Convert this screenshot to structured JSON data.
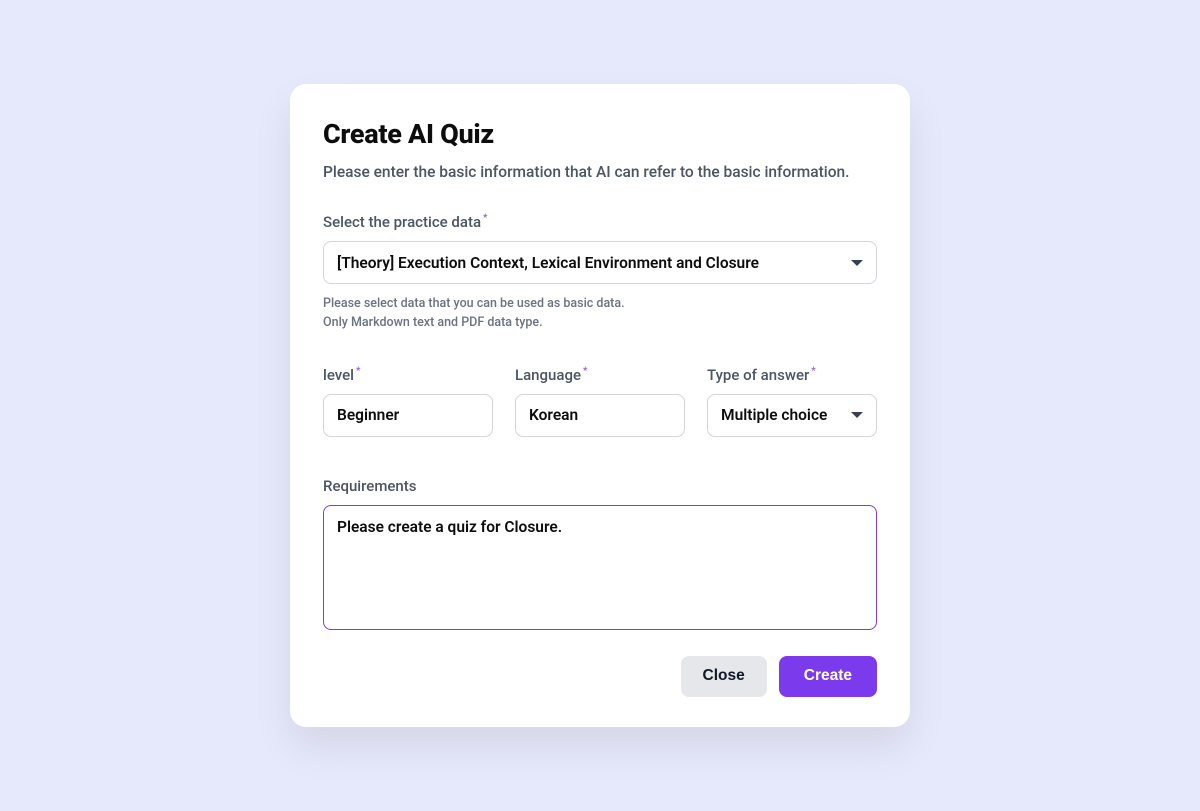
{
  "modal": {
    "title": "Create AI Quiz",
    "subtitle": "Please enter the basic information that AI can refer to the basic information."
  },
  "practice_data": {
    "label": "Select the practice data",
    "value": "[Theory] Execution Context, Lexical Environment and Closure",
    "help_line1": "Please select data that you can be used as basic data.",
    "help_line2": "Only Markdown text and PDF data type."
  },
  "level": {
    "label": "level",
    "value": "Beginner"
  },
  "language": {
    "label": "Language",
    "value": "Korean"
  },
  "answer_type": {
    "label": "Type of answer",
    "value": "Multiple choice"
  },
  "requirements": {
    "label": "Requirements",
    "value": "Please create a quiz for Closure."
  },
  "buttons": {
    "close": "Close",
    "create": "Create"
  },
  "colors": {
    "accent": "#7C3AED",
    "page_bg": "#E6E8FB",
    "text_muted": "#4B5563"
  }
}
